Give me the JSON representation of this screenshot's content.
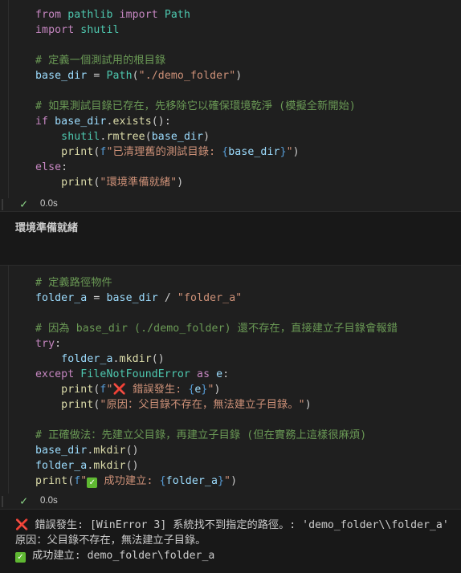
{
  "cell1": {
    "lines": [
      [
        [
          "kw",
          "from"
        ],
        [
          "pl",
          " "
        ],
        [
          "cls",
          "pathlib"
        ],
        [
          "pl",
          " "
        ],
        [
          "kw",
          "import"
        ],
        [
          "pl",
          " "
        ],
        [
          "cls",
          "Path"
        ]
      ],
      [
        [
          "kw",
          "import"
        ],
        [
          "pl",
          " "
        ],
        [
          "cls",
          "shutil"
        ]
      ],
      [],
      [
        [
          "cmt",
          "# 定義一個測試用的根目錄"
        ]
      ],
      [
        [
          "var",
          "base_dir"
        ],
        [
          "pl",
          " = "
        ],
        [
          "cls",
          "Path"
        ],
        [
          "pl",
          "("
        ],
        [
          "str",
          "\"./demo_folder\""
        ],
        [
          "pl",
          ")"
        ]
      ],
      [],
      [
        [
          "cmt",
          "# 如果測試目錄已存在，先移除它以確保環境乾淨 (模擬全新開始)"
        ]
      ],
      [
        [
          "kw",
          "if"
        ],
        [
          "pl",
          " "
        ],
        [
          "var",
          "base_dir"
        ],
        [
          "pl",
          "."
        ],
        [
          "fn",
          "exists"
        ],
        [
          "pl",
          "():"
        ]
      ],
      [
        [
          "pl",
          "    "
        ],
        [
          "cls",
          "shutil"
        ],
        [
          "pl",
          "."
        ],
        [
          "fn",
          "rmtree"
        ],
        [
          "pl",
          "("
        ],
        [
          "var",
          "base_dir"
        ],
        [
          "pl",
          ")"
        ]
      ],
      [
        [
          "pl",
          "    "
        ],
        [
          "fn",
          "print"
        ],
        [
          "pl",
          "("
        ],
        [
          "kw2",
          "f"
        ],
        [
          "str",
          "\"已清理舊的測試目錄: "
        ],
        [
          "kw2",
          "{"
        ],
        [
          "var",
          "base_dir"
        ],
        [
          "kw2",
          "}"
        ],
        [
          "str",
          "\""
        ],
        [
          "pl",
          ")"
        ]
      ],
      [
        [
          "kw",
          "else"
        ],
        [
          "pl",
          ":"
        ]
      ],
      [
        [
          "pl",
          "    "
        ],
        [
          "fn",
          "print"
        ],
        [
          "pl",
          "("
        ],
        [
          "str",
          "\"環境準備就緒\""
        ],
        [
          "pl",
          ")"
        ]
      ]
    ],
    "status_time": "0.0s",
    "output": "環境準備就緒"
  },
  "cell2": {
    "lines": [
      [
        [
          "cmt",
          "# 定義路徑物件"
        ]
      ],
      [
        [
          "var",
          "folder_a"
        ],
        [
          "pl",
          " = "
        ],
        [
          "var",
          "base_dir"
        ],
        [
          "pl",
          " / "
        ],
        [
          "str",
          "\"folder_a\""
        ]
      ],
      [],
      [
        [
          "cmt",
          "# 因為 base_dir (./demo_folder) 還不存在，直接建立子目錄會報錯"
        ]
      ],
      [
        [
          "kw",
          "try"
        ],
        [
          "pl",
          ":"
        ]
      ],
      [
        [
          "pl",
          "    "
        ],
        [
          "var",
          "folder_a"
        ],
        [
          "pl",
          "."
        ],
        [
          "fn",
          "mkdir"
        ],
        [
          "pl",
          "()"
        ]
      ],
      [
        [
          "kw",
          "except"
        ],
        [
          "pl",
          " "
        ],
        [
          "cls",
          "FileNotFoundError"
        ],
        [
          "pl",
          " "
        ],
        [
          "kw",
          "as"
        ],
        [
          "pl",
          " "
        ],
        [
          "var",
          "e"
        ],
        [
          "pl",
          ":"
        ]
      ],
      [
        [
          "pl",
          "    "
        ],
        [
          "fn",
          "print"
        ],
        [
          "pl",
          "("
        ],
        [
          "kw2",
          "f"
        ],
        [
          "str",
          "\""
        ],
        [
          "x",
          "❌"
        ],
        [
          "str",
          " 錯誤發生: "
        ],
        [
          "kw2",
          "{"
        ],
        [
          "var",
          "e"
        ],
        [
          "kw2",
          "}"
        ],
        [
          "str",
          "\""
        ],
        [
          "pl",
          ")"
        ]
      ],
      [
        [
          "pl",
          "    "
        ],
        [
          "fn",
          "print"
        ],
        [
          "pl",
          "("
        ],
        [
          "str",
          "\"原因：父目錄不存在，無法建立子目錄。\""
        ],
        [
          "pl",
          ")"
        ]
      ],
      [],
      [
        [
          "cmt",
          "# 正確做法：先建立父目錄，再建立子目錄 (但在實務上這樣很麻煩)"
        ]
      ],
      [
        [
          "var",
          "base_dir"
        ],
        [
          "pl",
          "."
        ],
        [
          "fn",
          "mkdir"
        ],
        [
          "pl",
          "()"
        ]
      ],
      [
        [
          "var",
          "folder_a"
        ],
        [
          "pl",
          "."
        ],
        [
          "fn",
          "mkdir"
        ],
        [
          "pl",
          "()"
        ]
      ],
      [
        [
          "fn",
          "print"
        ],
        [
          "pl",
          "("
        ],
        [
          "kw2",
          "f"
        ],
        [
          "str",
          "\""
        ],
        [
          "ok",
          "✓"
        ],
        [
          "str",
          " 成功建立: "
        ],
        [
          "kw2",
          "{"
        ],
        [
          "var",
          "folder_a"
        ],
        [
          "kw2",
          "}"
        ],
        [
          "str",
          "\""
        ],
        [
          "pl",
          ")"
        ]
      ]
    ],
    "status_time": "0.0s",
    "output": [
      {
        "icon": "x",
        "text": " 錯誤發生: [WinError 3] 系統找不到指定的路徑。: 'demo_folder\\\\folder_a'"
      },
      {
        "icon": "",
        "text": "原因：父目錄不存在，無法建立子目錄。"
      },
      {
        "icon": "ok",
        "text": " 成功建立: demo_folder\\folder_a"
      }
    ]
  },
  "icons": {
    "check": "check-icon",
    "error": "cross-mark-icon",
    "success": "check-box-icon"
  },
  "colors": {
    "background": "#1f1f1f",
    "keyword": "#c586c0",
    "string": "#ce9178",
    "comment": "#6a9955",
    "function": "#dcdcaa",
    "class": "#4ec9b0",
    "variable": "#9cdcfe",
    "success": "#89d185"
  }
}
